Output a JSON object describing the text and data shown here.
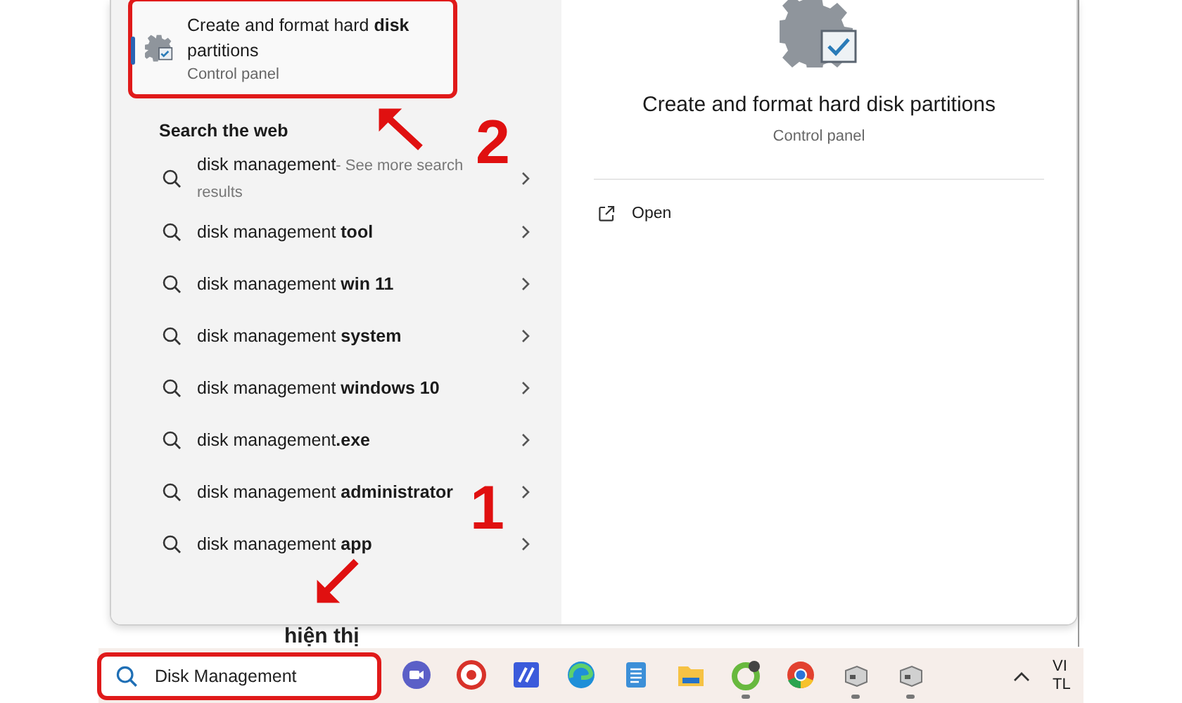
{
  "top_result": {
    "title": "Create and format hard **disk** partitions",
    "subtitle": "Control panel",
    "selected": true,
    "highlighted": true
  },
  "section_heading": "Search the web",
  "web_results": [
    {
      "text": "disk management",
      "suffix": "- See more search results"
    },
    {
      "text": "disk management **tool**"
    },
    {
      "text": "disk management **win 11**"
    },
    {
      "text": "disk management **system**"
    },
    {
      "text": "disk management **windows 10**"
    },
    {
      "text": "disk management**.exe**"
    },
    {
      "text": "disk management **administrator**"
    },
    {
      "text": "disk management **app**"
    }
  ],
  "detail": {
    "title": "Create and format hard disk partitions",
    "subtitle": "Control panel",
    "actions": [
      {
        "label": "Open"
      }
    ]
  },
  "background_text": "hiện thị",
  "taskbar": {
    "search": {
      "value": "Disk Management",
      "highlighted": true
    },
    "apps": [
      {
        "kind": "meet",
        "running": false
      },
      {
        "kind": "red-circle",
        "running": false
      },
      {
        "kind": "pen",
        "running": false
      },
      {
        "kind": "edge",
        "running": false
      },
      {
        "kind": "notepad",
        "running": false
      },
      {
        "kind": "folder",
        "running": false
      },
      {
        "kind": "green-ring",
        "running": true
      },
      {
        "kind": "chrome",
        "running": false
      },
      {
        "kind": "device",
        "running": true
      },
      {
        "kind": "device",
        "running": true
      }
    ],
    "clock_partial": [
      "VI",
      "TL"
    ]
  },
  "annotations": [
    {
      "kind": "number",
      "text": "2"
    },
    {
      "kind": "arrow"
    },
    {
      "kind": "number",
      "text": "1"
    },
    {
      "kind": "arrow"
    }
  ]
}
